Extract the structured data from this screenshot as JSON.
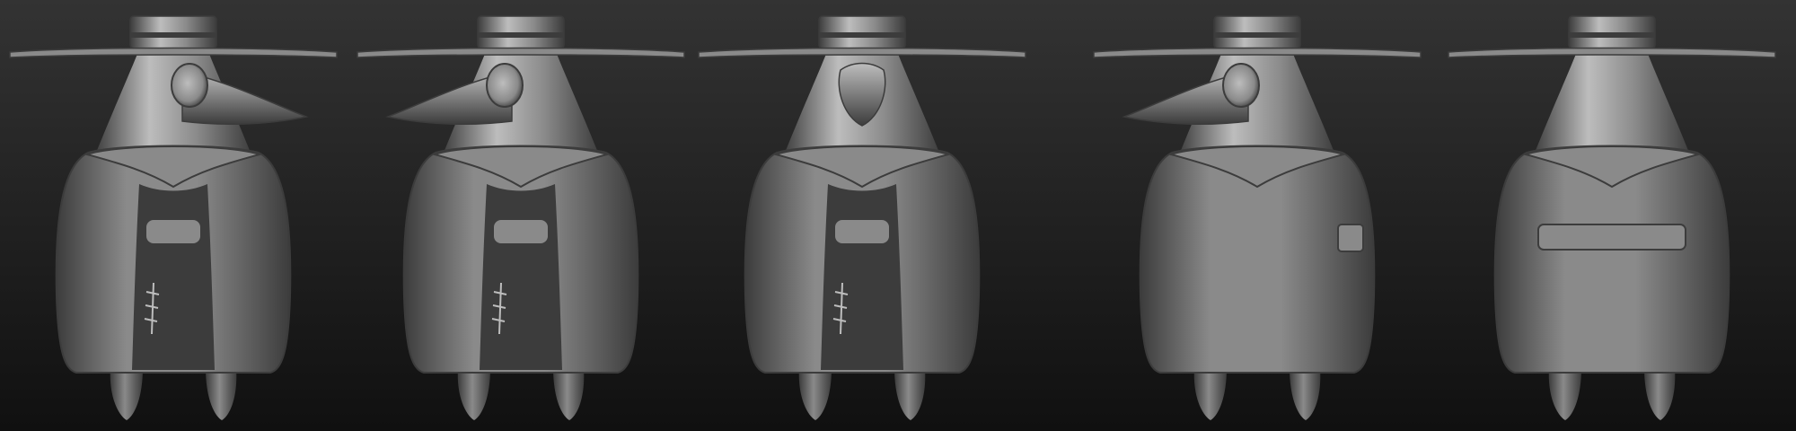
{
  "scene": {
    "background_top": "#333333",
    "background_bottom": "#101010",
    "material": "#8a8a8a",
    "material_light": "#bdbdbd",
    "material_dark": "#3c3c3c",
    "figure": "plague-doctor-sculpt",
    "views": [
      {
        "name": "three-quarter-right",
        "beak": "right",
        "face": true,
        "back_strap": false,
        "seam": true
      },
      {
        "name": "three-quarter-left",
        "beak": "left",
        "face": true,
        "back_strap": false,
        "seam": true
      },
      {
        "name": "front",
        "beak": "front",
        "face": true,
        "back_strap": false,
        "seam": true
      },
      {
        "name": "side-left",
        "beak": "left",
        "face": false,
        "back_strap": false,
        "seam": false
      },
      {
        "name": "back",
        "beak": "none",
        "face": false,
        "back_strap": true,
        "seam": false
      }
    ]
  }
}
